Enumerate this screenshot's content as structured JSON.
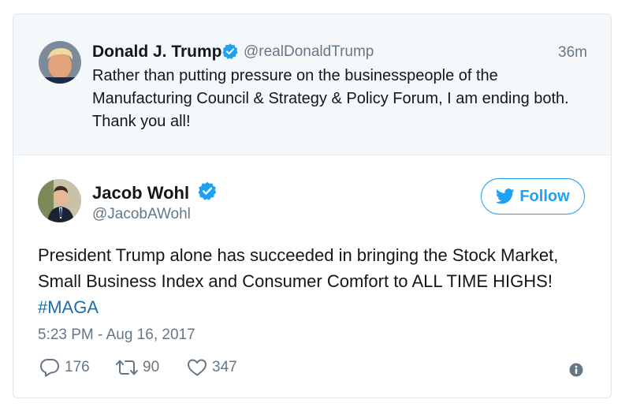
{
  "quoted_tweet": {
    "name": "Donald J. Trump",
    "handle": "@realDonaldTrump",
    "time": "36m",
    "text": "Rather than putting pressure on the businesspeople of the Manufacturing Council & Strategy & Policy Forum, I am ending both. Thank you all!"
  },
  "main_tweet": {
    "name": "Jacob Wohl",
    "handle": "@JacobAWohl",
    "follow_label": "Follow",
    "text": "President Trump alone has succeeded in bringing the Stock Market, Small Business Index and Consumer Comfort to ALL TIME HIGHS!",
    "hashtag": "#MAGA",
    "timestamp": "5:23 PM - Aug 16, 2017",
    "reply_count": "176",
    "retweet_count": "90",
    "like_count": "347"
  },
  "colors": {
    "accent": "#1da1f2",
    "secondary_text": "#657786",
    "quoted_background": "#f5f8fa",
    "hashtag": "#1b6ea8"
  },
  "icons": [
    "verified-badge-icon",
    "twitter-bird-icon",
    "reply-icon",
    "retweet-icon",
    "heart-icon",
    "info-icon"
  ]
}
